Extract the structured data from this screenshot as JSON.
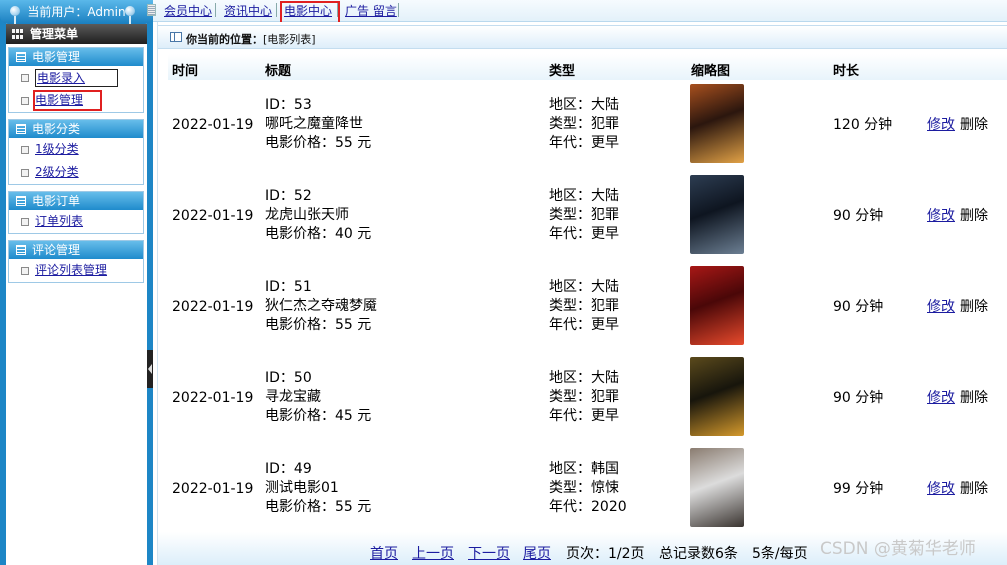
{
  "sidebar": {
    "user_label": "当前用户：Admin",
    "menu_title": "管理菜单",
    "groups": [
      {
        "title": "电影管理",
        "items": [
          {
            "label": "电影录入"
          },
          {
            "label": "电影管理"
          }
        ]
      },
      {
        "title": "电影分类",
        "items": [
          {
            "label": "1级分类"
          },
          {
            "label": "2级分类"
          }
        ]
      },
      {
        "title": "电影订单",
        "items": [
          {
            "label": "订单列表"
          }
        ]
      },
      {
        "title": "评论管理",
        "items": [
          {
            "label": "评论列表管理"
          }
        ]
      }
    ]
  },
  "topnav": {
    "items": [
      "会员中心",
      "资讯中心",
      "电影中心",
      "广告 留言"
    ]
  },
  "breadcrumb": {
    "label": "你当前的位置：",
    "value": "[电影列表]"
  },
  "table": {
    "headers": {
      "time": "时间",
      "title": "标题",
      "type": "类型",
      "thumb": "缩略图",
      "duration": "时长"
    },
    "rows": [
      {
        "date": "2022-01-19",
        "id": "ID：53",
        "name": "哪吒之魔童降世",
        "price": "电影价格：55 元",
        "region": "地区：大陆",
        "genre": "类型：犯罪",
        "year": "年代：更早",
        "duration": "120 分钟",
        "edit": "修改",
        "del": "删除",
        "poster_colors": [
          "#2b160e",
          "#a8501e",
          "#e2a246"
        ]
      },
      {
        "date": "2022-01-19",
        "id": "ID：52",
        "name": "龙虎山张天师",
        "price": "电影价格：40 元",
        "region": "地区：大陆",
        "genre": "类型：犯罪",
        "year": "年代：更早",
        "duration": "90 分钟",
        "edit": "修改",
        "del": "删除",
        "poster_colors": [
          "#0e1520",
          "#2d3d52",
          "#6c7f93"
        ]
      },
      {
        "date": "2022-01-19",
        "id": "ID：51",
        "name": "狄仁杰之夺魂梦魇",
        "price": "电影价格：55 元",
        "region": "地区：大陆",
        "genre": "类型：犯罪",
        "year": "年代：更早",
        "duration": "90 分钟",
        "edit": "修改",
        "del": "删除",
        "poster_colors": [
          "#4a0708",
          "#a81816",
          "#e84a2c"
        ]
      },
      {
        "date": "2022-01-19",
        "id": "ID：50",
        "name": "寻龙宝藏",
        "price": "电影价格：45 元",
        "region": "地区：大陆",
        "genre": "类型：犯罪",
        "year": "年代：更早",
        "duration": "90 分钟",
        "edit": "修改",
        "del": "删除",
        "poster_colors": [
          "#17150c",
          "#5b4a1c",
          "#d59a2c"
        ]
      },
      {
        "date": "2022-01-19",
        "id": "ID：49",
        "name": "测试电影01",
        "price": "电影价格：55 元",
        "region": "地区：韩国",
        "genre": "类型：惊悚",
        "year": "年代：2020",
        "duration": "99 分钟",
        "edit": "修改",
        "del": "删除",
        "poster_colors": [
          "#dcdcdc",
          "#8a7c70",
          "#3a3430"
        ]
      }
    ]
  },
  "pager": {
    "first": "首页",
    "prev": "上一页",
    "next": "下一页",
    "last": "尾页",
    "pages": "页次：1/2页",
    "total": "总记录数6条",
    "per_page": "5条/每页"
  },
  "watermark": "CSDN @黄菊华老师"
}
